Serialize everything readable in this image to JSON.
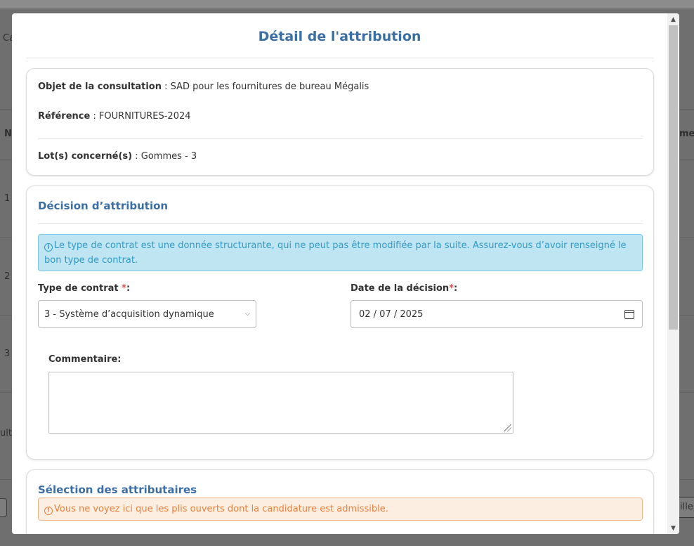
{
  "background": {
    "fragments": [
      "Ca",
      "N",
      "1",
      "2",
      "3",
      "ulta",
      "men",
      "ille"
    ]
  },
  "modal": {
    "title": "Détail de l'attribution"
  },
  "summary": {
    "objet_label": "Objet de la consultation",
    "objet_value": " : SAD pour les fournitures de bureau Mégalis",
    "reference_label": "Référence",
    "reference_value": " : FOURNITURES-2024",
    "lots_label": "Lot(s) concerné(s)",
    "lots_value": " : Gommes - 3"
  },
  "decision": {
    "section_title": "Décision d’attribution",
    "info_alert": "Le type de contrat est une donnée structurante, qui ne peut pas être modifiée par la suite. Assurez-vous d’avoir renseigné le bon type de contrat.",
    "contract_type_label": "Type de contrat ",
    "contract_type_required": "*",
    "contract_type_colon": ":",
    "contract_type_value": "3 - Système d’acquisition dynamique",
    "decision_date_label": "Date de la décision",
    "decision_date_required": "*",
    "decision_date_colon": ":",
    "decision_date_value": "02 / 07 / 2025",
    "comment_label": "Commentaire:",
    "comment_value": ""
  },
  "selection": {
    "section_title": "Sélection des attributaires",
    "warning_alert": "Vous ne voyez ici que les plis ouverts dont la candidature est admissible."
  },
  "colors": {
    "accent": "#3a6ea5",
    "info_bg": "#bfe5f3",
    "info_text": "#2f9cc7",
    "warn_bg": "#fdeee2",
    "warn_text": "#e9813d",
    "required": "#d9534f"
  },
  "icons": [
    "info-circle-icon",
    "warning-circle-icon",
    "chevron-down-icon",
    "calendar-icon",
    "resize-grip-icon"
  ]
}
